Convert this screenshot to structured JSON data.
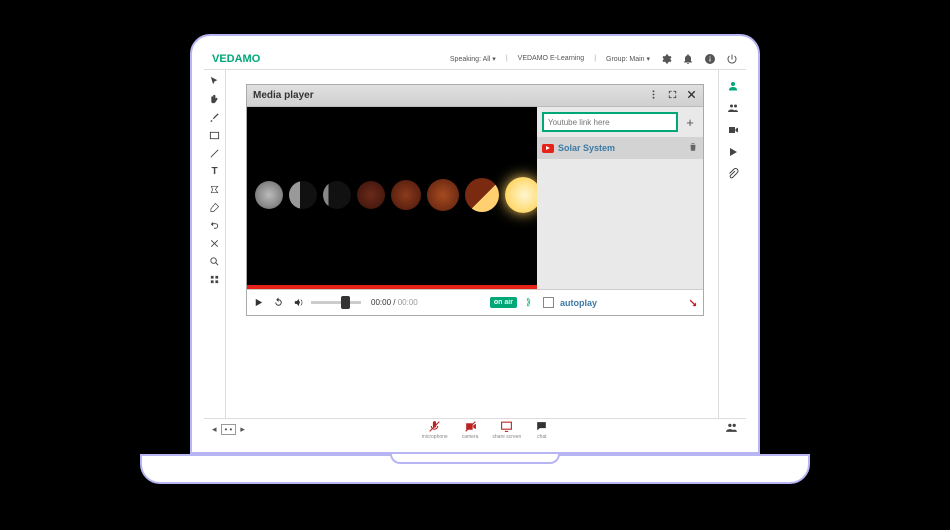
{
  "brand": "VEDAMO",
  "header": {
    "speaking_label": "Speaking: All ▾",
    "learning_label": "VEDAMO E-Learning",
    "group_label": "Group: Main ▾"
  },
  "media_player": {
    "title": "Media player",
    "time_current": "00:00",
    "time_duration": "00:00",
    "onair": "on air",
    "youtube_placeholder": "Youtube link here",
    "add_symbol": "+",
    "playlist": [
      {
        "title": "Solar System"
      }
    ],
    "autoplay_label": "autoplay"
  },
  "bottom": {
    "mic_label": "microphone",
    "cam_label": "camera",
    "share_label": "share screen",
    "chat_label": "chat"
  }
}
